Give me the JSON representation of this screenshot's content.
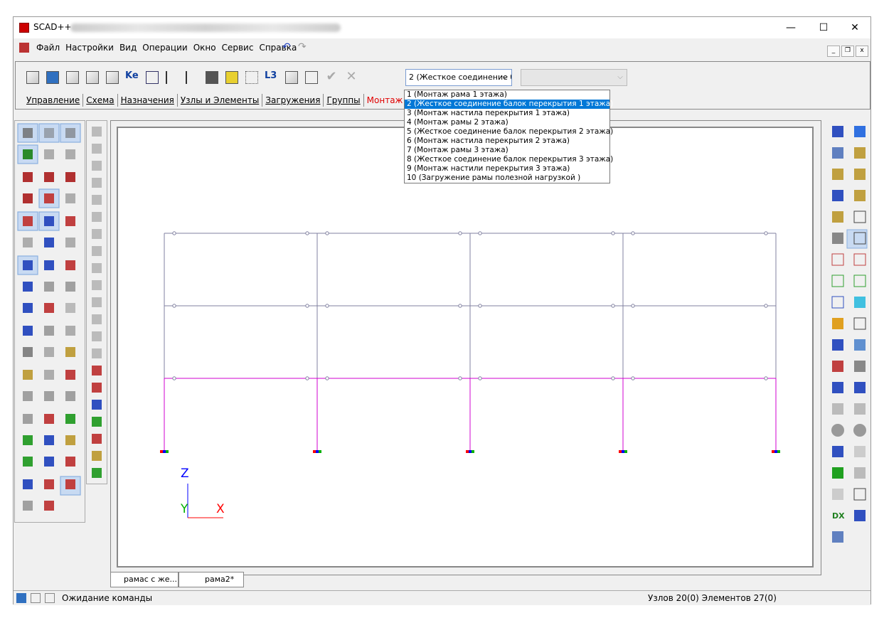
{
  "window": {
    "title": "SCAD++",
    "minimize": "—",
    "maximize": "☐",
    "close": "✕"
  },
  "menu": {
    "items": [
      "Файл",
      "Настройки",
      "Вид",
      "Операции",
      "Окно",
      "Сервис",
      "Справка"
    ],
    "undo": "↶",
    "redo": "↷"
  },
  "mdi": {
    "minimize": "_",
    "restore": "❐",
    "close": "x"
  },
  "toolbar": {
    "icons": [
      "load-icon",
      "settings-icon",
      "node-load-icon",
      "element-load-icon",
      "group-load-icon",
      "ke-icon",
      "support-icon",
      "node-add-icon",
      "node-delete-icon",
      "layer-icon",
      "paint-icon",
      "move-icon",
      "l3-icon",
      "assembly-icon",
      "group-edit-icon",
      "check-icon",
      "cross-icon"
    ],
    "ke_label": "Ke",
    "l3_label": "L3",
    "apply": "✔",
    "cancel": "✕",
    "stage_combo_value": "2 (Жесткое соединение б",
    "stage_combo_arrow": "⌵",
    "second_combo_arrow": "⌵"
  },
  "tabs": [
    "Управление",
    "Схема",
    "Назначения",
    "Узлы и Элементы",
    "Загружения",
    "Группы",
    "Монтаж"
  ],
  "active_tab": "Монтаж",
  "dropdown": {
    "items": [
      "1 (Монтаж рама 1 этажа)",
      "2 (Жесткое соединение балок перекрытия 1 этажа)",
      "3 (Монтаж настила перекрытия 1 этажа)",
      "4 (Монтаж рамы 2 этажа)",
      "5 (Жесткое соединение балок перекрытия 2 этажа)",
      "6 (Монтаж настила перекрытия 2 этажа)",
      "7 (Монтаж рамы 3 этажа)",
      "8 (Жесткое соединение балок перекрытия 3 этажа)",
      "9 (Монтаж настили перекрытия 3 этажа)",
      "10 (Загружение рамы полезной нагрузкой )"
    ],
    "selected_index": 1
  },
  "axes": {
    "z": "Z",
    "y": "Y",
    "x": "X"
  },
  "doc_tabs": [
    "рамас с же...",
    "рама2*"
  ],
  "status": {
    "message": "Ожидание команды",
    "counts": "Узлов 20(0) Элементов 27(0)"
  },
  "colors": {
    "frame_gray": "#8080a0",
    "frame_magenta": "#d000d0",
    "highlight": "#0078d7",
    "active_tab": "#e00000",
    "axis_z": "#0000ff",
    "axis_y": "#00b000",
    "axis_x": "#ff0000"
  }
}
